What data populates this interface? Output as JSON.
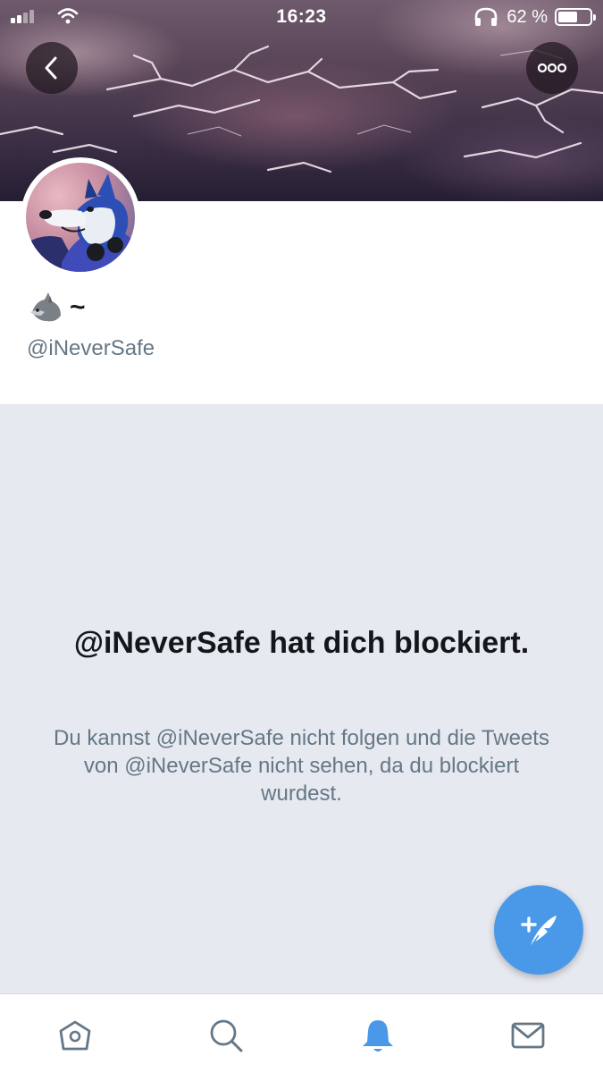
{
  "status_bar": {
    "time": "16:23",
    "battery_percent": "62 %",
    "battery_level": 0.62,
    "icons": [
      "cellular-signal-icon",
      "wifi-icon",
      "headphones-icon",
      "battery-icon"
    ]
  },
  "header": {
    "back_icon": "chevron-left-icon",
    "more_icon": "more-dots-icon"
  },
  "profile": {
    "display_name_emoji": "🐺",
    "display_name_text": "~",
    "handle": "@iNeverSafe"
  },
  "blocked": {
    "title": "@iNeverSafe hat dich blockiert.",
    "description": "Du kannst @iNeverSafe nicht folgen und die Tweets von @iNeverSafe nicht sehen, da du blockiert wurdest."
  },
  "fab": {
    "icon": "compose-tweet-icon",
    "color": "#4a99e9"
  },
  "tabbar": {
    "tabs": [
      {
        "name": "home",
        "icon": "home-icon",
        "active": false
      },
      {
        "name": "search",
        "icon": "search-icon",
        "active": false
      },
      {
        "name": "notifications",
        "icon": "bell-icon",
        "active": true
      },
      {
        "name": "messages",
        "icon": "envelope-icon",
        "active": false
      }
    ],
    "active_color": "#4a99e9",
    "inactive_color": "#657786"
  }
}
